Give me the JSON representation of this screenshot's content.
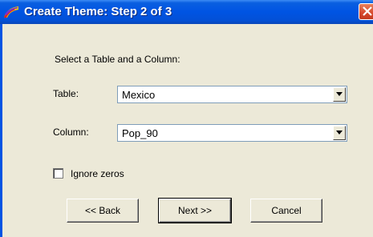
{
  "window": {
    "title": "Create Theme: Step 2 of 3",
    "title_color": "#ffffff",
    "titlebar_color": "#0054e3",
    "close_color": "#d6482c"
  },
  "form": {
    "instruction": "Select a Table and a Column:",
    "table_label": "Table:",
    "table_value": "Mexico",
    "column_label": "Column:",
    "column_value": "Pop_90",
    "ignore_zeros_label": "Ignore zeros",
    "ignore_zeros_checked": false
  },
  "buttons": {
    "back": "<< Back",
    "next": "Next >>",
    "cancel": "Cancel"
  },
  "icons": {
    "app": "app-rainbow-icon",
    "close": "close-icon",
    "dropdown": "chevron-down-icon"
  }
}
